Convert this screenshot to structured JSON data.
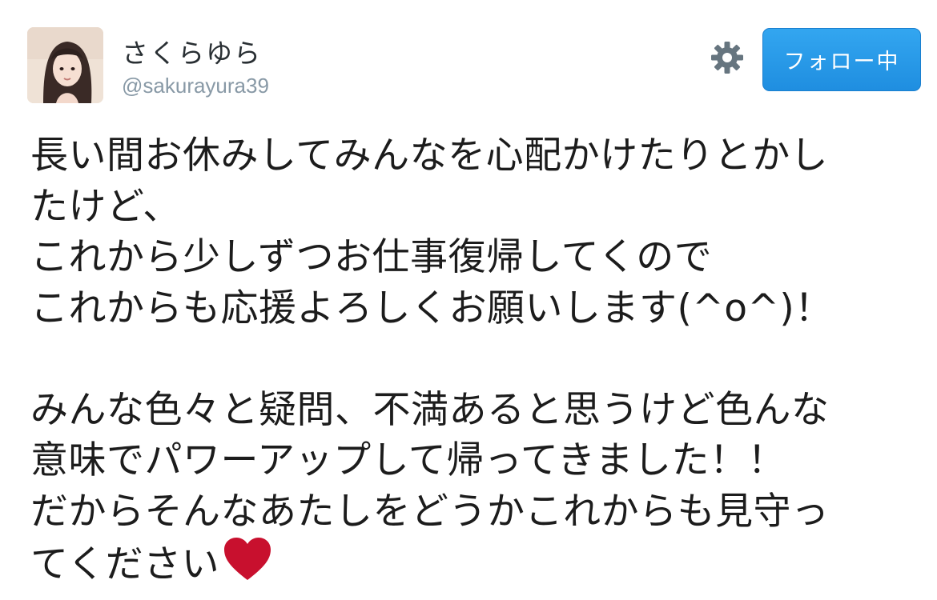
{
  "user": {
    "display_name": "さくらゆら",
    "handle": "@sakurayura39"
  },
  "actions": {
    "settings_icon": "gear-icon",
    "follow_label": "フォロー中"
  },
  "tweet": {
    "lines": [
      "長い間お休みしてみんなを心配かけたりとかし",
      "たけど、",
      "これから少しずつお仕事復帰してくので",
      "これからも応援よろしくお願いします(^o^)！",
      "",
      "みんな色々と疑問、不満あると思うけど色んな",
      "意味でパワーアップして帰ってきました！！",
      "だからそんなあたしをどうかこれからも見守っ",
      "てください"
    ],
    "emoji": "heart-icon"
  },
  "colors": {
    "follow_button": "#1f8ee0",
    "handle": "#8899a6",
    "heart": "#c8102e",
    "gear": "#66757f"
  }
}
